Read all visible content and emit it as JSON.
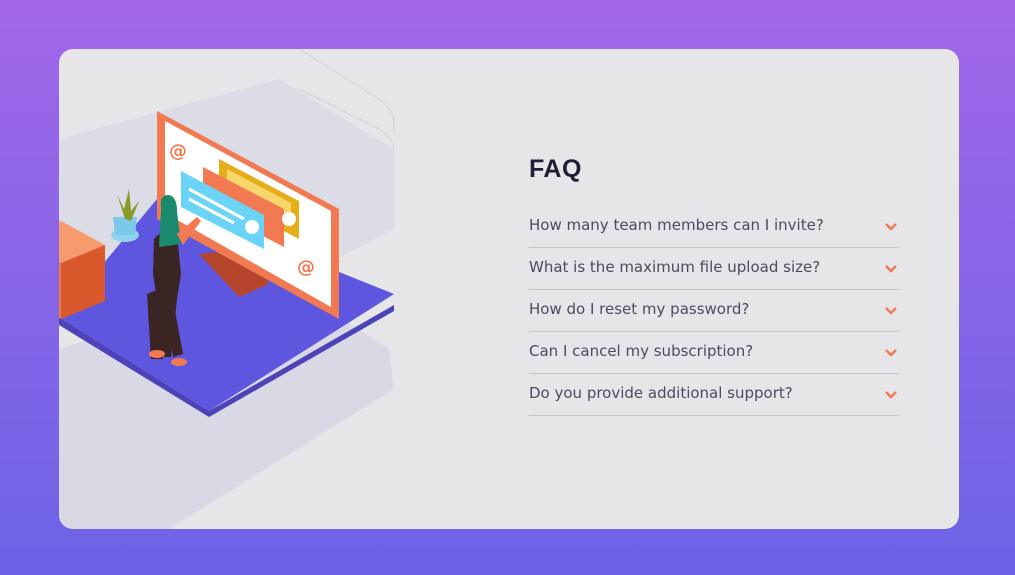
{
  "page": {
    "background_gradient": [
      "#a267e8",
      "#6c63e6"
    ],
    "card_color": "#e6e6e8"
  },
  "illustration": {
    "icons": [
      "at-sign-icon",
      "plant-icon",
      "monitor-icon",
      "person-icon",
      "box-icon"
    ],
    "colors": {
      "platform": "#5f56e0",
      "monitor_frame": "#f27a52",
      "cube": "#f0784a",
      "chat_blue": "#6bd3f5",
      "chat_yellow": "#e5ad19"
    }
  },
  "faq": {
    "title": "FAQ",
    "accent_color": "#f27a52",
    "items": [
      {
        "question": "How many team members can I invite?",
        "icon": "chevron-down-icon"
      },
      {
        "question": "What is the maximum file upload size?",
        "icon": "chevron-down-icon"
      },
      {
        "question": "How do I reset my password?",
        "icon": "chevron-down-icon"
      },
      {
        "question": "Can I cancel my subscription?",
        "icon": "chevron-down-icon"
      },
      {
        "question": "Do you provide additional support?",
        "icon": "chevron-down-icon"
      }
    ]
  }
}
